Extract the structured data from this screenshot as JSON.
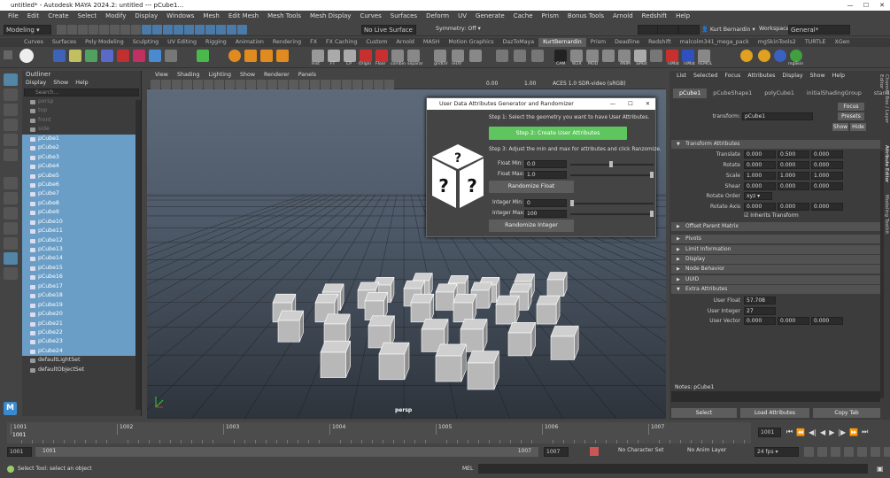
{
  "title_bar": {
    "title": "untitled* - Autodesk MAYA 2024.2: untitled  ---  pCube1..."
  },
  "menu": [
    "File",
    "Edit",
    "Create",
    "Select",
    "Modify",
    "Display",
    "Windows",
    "Mesh",
    "Edit Mesh",
    "Mesh Tools",
    "Mesh Display",
    "Curves",
    "Surfaces",
    "Deform",
    "UV",
    "Generate",
    "Cache",
    "Prism",
    "Bonus Tools",
    "Arnold",
    "Redshift",
    "Help"
  ],
  "status_line": {
    "mode": "Modeling",
    "live_surface": "No Live Surface",
    "symmetry": "Symmetry: Off",
    "user": "Kurt Bernardin",
    "workspace_label": "Workspace:",
    "workspace": "General*"
  },
  "shelf_tabs": [
    "Curves",
    "Surfaces",
    "Poly Modeling",
    "Sculpting",
    "UV Editing",
    "Rigging",
    "Animation",
    "Rendering",
    "FX",
    "FX Caching",
    "Custom",
    "Arnold",
    "MASH",
    "Motion Graphics",
    "DazToMaya",
    "KurtBernardin",
    "Prism",
    "Deadline",
    "Redshift",
    "malcolm341_mega_pack",
    "mgSkinTools2",
    "TURTLE",
    "XGen"
  ],
  "shelf_active": "KurtBernardin",
  "shelf_labels": [
    "Hist",
    "FT",
    "CP",
    "Origin",
    "Floor",
    "combin",
    "separar",
    "gridUV",
    "reUV",
    "CAM",
    "W2X",
    "MOD",
    "ANIM",
    "aiMat",
    "rsMat",
    "rsMat",
    "REMOL",
    "mgSkin"
  ],
  "outliner": {
    "title": "Outliner",
    "menu": [
      "Display",
      "Show",
      "Help"
    ],
    "search_placeholder": "Search...",
    "cameras": [
      "persp",
      "top",
      "front",
      "side"
    ],
    "items": [
      "pCube1",
      "pCube2",
      "pCube3",
      "pCube4",
      "pCube5",
      "pCube6",
      "pCube7",
      "pCube8",
      "pCube9",
      "pCube10",
      "pCube11",
      "pCube12",
      "pCube13",
      "pCube14",
      "pCube15",
      "pCube16",
      "pCube17",
      "pCube18",
      "pCube19",
      "pCube20",
      "pCube21",
      "pCube22",
      "pCube23",
      "pCube24"
    ],
    "sets": [
      "defaultLightSet",
      "defaultObjectSet"
    ]
  },
  "viewport": {
    "menu": [
      "View",
      "Shading",
      "Lighting",
      "Show",
      "Renderer",
      "Panels"
    ],
    "exposure": "0.00",
    "gamma": "1.00",
    "color_space": "ACES 1.0 SDR-video (sRGB)",
    "camera_label": "persp"
  },
  "dialog": {
    "title": "User Data Attributes Generator and Randomizer",
    "step1": "Step 1: Select the geometry you want to have User Attributes.",
    "step2_button": "Step 2: Create User Attributes",
    "step3": "Step 3: Adjust the min and max for attributes and click Ranzomize.",
    "float_min_label": "Float Min:",
    "float_min": "0.0",
    "float_max_label": "Float Max:",
    "float_max": "1.0",
    "randomize_float": "Randomize Float",
    "int_min_label": "Integer Min:",
    "int_min": "0",
    "int_max_label": "Integer Max:",
    "int_max": "100",
    "randomize_int": "Randomize Integer"
  },
  "attribute_editor": {
    "menu": [
      "List",
      "Selected",
      "Focus",
      "Attributes",
      "Display",
      "Show",
      "Help"
    ],
    "tabs": [
      "pCube1",
      "pCubeShape1",
      "polyCube1",
      "initialShadingGroup",
      "standar"
    ],
    "transform_label": "transform:",
    "transform_value": "pCube1",
    "focus_btn": "Focus",
    "presets_btn": "Presets",
    "show_btn": "Show",
    "hide_btn": "Hide",
    "sections": {
      "transform": "Transform Attributes",
      "offset": "Offset Parent Matrix",
      "pivots": "Pivots",
      "limit": "Limit Information",
      "display": "Display",
      "node": "Node Behavior",
      "uuid": "UUID",
      "extra": "Extra Attributes"
    },
    "translate_label": "Translate",
    "translate": [
      "0.000",
      "0.500",
      "0.000"
    ],
    "rotate_label": "Rotate",
    "rotate": [
      "0.000",
      "0.000",
      "0.000"
    ],
    "scale_label": "Scale",
    "scale": [
      "1.000",
      "1.000",
      "1.000"
    ],
    "shear_label": "Shear",
    "shear": [
      "0.000",
      "0.000",
      "0.000"
    ],
    "rotate_order_label": "Rotate Order",
    "rotate_order": "xyz",
    "rotate_axis_label": "Rotate Axis",
    "rotate_axis": [
      "0.000",
      "0.000",
      "0.000"
    ],
    "inherits": "Inherits Transform",
    "user_float_label": "User Float",
    "user_float": "57.708",
    "user_integer_label": "User Integer",
    "user_integer": "27",
    "user_vector_label": "User Vector",
    "user_vector": [
      "0.000",
      "0.000",
      "0.000"
    ],
    "notes": "Notes:  pCube1",
    "select_btn": "Select",
    "load_btn": "Load Attributes",
    "copy_btn": "Copy Tab"
  },
  "side_tabs": [
    "Channel Box / Layer Editor",
    "Attribute Editor",
    "Modeling Toolkit"
  ],
  "timeline": {
    "current": "1001",
    "ticks": [
      "1001",
      "1002",
      "1003",
      "1004",
      "1005",
      "1006",
      "1007"
    ],
    "range_start": "1001",
    "anim_start": "1001",
    "range_end": "1007",
    "anim_end": "1007",
    "character_set": "No Character Set",
    "anim_layer": "No Anim Layer",
    "fps": "24 fps"
  },
  "help_line": {
    "text": "Select Tool: select an object",
    "mel": "MEL"
  },
  "colors": {
    "selection": "#6a9ec7",
    "green_button": "#5fc65f",
    "bg": "#444444"
  }
}
